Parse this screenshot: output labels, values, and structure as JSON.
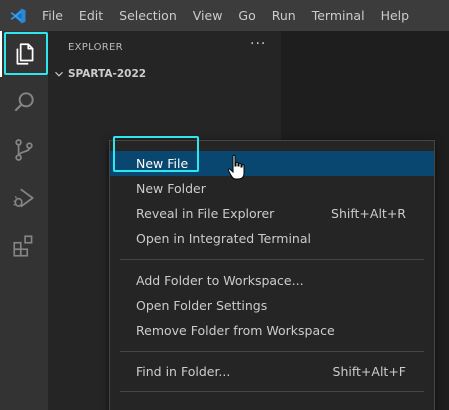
{
  "menubar": {
    "items": [
      "File",
      "Edit",
      "Selection",
      "View",
      "Go",
      "Run",
      "Terminal",
      "Help"
    ]
  },
  "activitybar": {
    "items": [
      {
        "name": "explorer",
        "icon": "files-icon",
        "active": true
      },
      {
        "name": "search",
        "icon": "search-icon",
        "active": false
      },
      {
        "name": "source-control",
        "icon": "source-control-icon",
        "active": false
      },
      {
        "name": "run-and-debug",
        "icon": "run-debug-icon",
        "active": false
      },
      {
        "name": "extensions",
        "icon": "extensions-icon",
        "active": false
      }
    ]
  },
  "sidebar": {
    "title": "EXPLORER",
    "more": "···",
    "folder": "SPARTA-2022"
  },
  "context_menu": {
    "items": [
      {
        "label": "New File",
        "shortcut": "",
        "selected": true
      },
      {
        "label": "New Folder",
        "shortcut": ""
      },
      {
        "label": "Reveal in File Explorer",
        "shortcut": "Shift+Alt+R"
      },
      {
        "label": "Open in Integrated Terminal",
        "shortcut": ""
      },
      {
        "label": "Add Folder to Workspace...",
        "shortcut": ""
      },
      {
        "label": "Open Folder Settings",
        "shortcut": ""
      },
      {
        "label": "Remove Folder from Workspace",
        "shortcut": ""
      },
      {
        "label": "Find in Folder...",
        "shortcut": "Shift+Alt+F"
      }
    ]
  },
  "colors": {
    "accent_highlight": "#2ee6ee",
    "selection": "#094771",
    "vscode_blue": "#3b9ee8"
  }
}
